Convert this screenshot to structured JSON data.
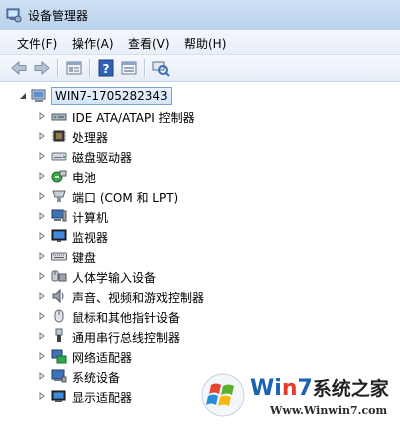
{
  "window": {
    "title": "设备管理器"
  },
  "menu": [
    {
      "label": "文件(F)"
    },
    {
      "label": "操作(A)"
    },
    {
      "label": "查看(V)"
    },
    {
      "label": "帮助(H)"
    }
  ],
  "toolbar": {
    "buttons": [
      "back-icon",
      "forward-icon",
      "properties-icon",
      "help-icon",
      "view-icon",
      "scan-hardware-icon"
    ]
  },
  "tree": {
    "root": {
      "label": "WIN7-1705282343",
      "icon": "computer-icon"
    },
    "items": [
      {
        "label": "IDE ATA/ATAPI 控制器",
        "icon": "ide-controller-icon"
      },
      {
        "label": "处理器",
        "icon": "processor-icon"
      },
      {
        "label": "磁盘驱动器",
        "icon": "disk-drive-icon"
      },
      {
        "label": "电池",
        "icon": "battery-icon"
      },
      {
        "label": "端口 (COM 和 LPT)",
        "icon": "port-icon"
      },
      {
        "label": "计算机",
        "icon": "computer-icon"
      },
      {
        "label": "监视器",
        "icon": "monitor-icon"
      },
      {
        "label": "键盘",
        "icon": "keyboard-icon"
      },
      {
        "label": "人体学输入设备",
        "icon": "hid-icon"
      },
      {
        "label": "声音、视频和游戏控制器",
        "icon": "sound-icon"
      },
      {
        "label": "鼠标和其他指针设备",
        "icon": "mouse-icon"
      },
      {
        "label": "通用串行总线控制器",
        "icon": "usb-icon"
      },
      {
        "label": "网络适配器",
        "icon": "network-icon"
      },
      {
        "label": "系统设备",
        "icon": "system-device-icon"
      },
      {
        "label": "显示适配器",
        "icon": "display-adapter-icon"
      }
    ]
  },
  "watermark": {
    "brand_prefix": "Wi",
    "brand_n": "n",
    "brand_7": "7",
    "brand_suffix": "系统之家",
    "url": "Www.Winwin7.com"
  },
  "colors": {
    "accent": "#1b62b5",
    "selection_border": "#7da2ce"
  }
}
